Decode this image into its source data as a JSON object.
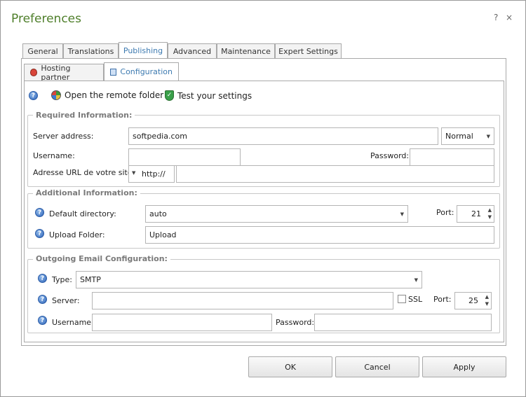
{
  "window": {
    "title": "Preferences",
    "help": "?",
    "close": "×"
  },
  "tabs": [
    {
      "label": "General"
    },
    {
      "label": "Translations"
    },
    {
      "label": "Publishing"
    },
    {
      "label": "Advanced"
    },
    {
      "label": "Maintenance"
    },
    {
      "label": "Expert Settings"
    }
  ],
  "subtabs": [
    {
      "label": "Hosting partner"
    },
    {
      "label": "Configuration"
    }
  ],
  "toolbar": {
    "open_remote": "Open the remote folder",
    "test_settings": "Test your settings"
  },
  "required": {
    "legend": "Required Information:",
    "server_label": "Server address:",
    "server_value": "softpedia.com",
    "mode": "Normal",
    "username_label": "Username:",
    "username_value": "",
    "password_label": "Password:",
    "password_value": "",
    "url_label": "Adresse URL de votre site :",
    "protocol": "http://",
    "url_value": ""
  },
  "additional": {
    "legend": "Additional Information:",
    "directory_label": "Default directory:",
    "directory_value": "auto",
    "port_label": "Port:",
    "port_value": "21",
    "upload_label": "Upload Folder:",
    "upload_value": "Upload"
  },
  "email": {
    "legend": "Outgoing Email Configuration:",
    "type_label": "Type:",
    "type_value": "SMTP",
    "server_label": "Server:",
    "server_value": "",
    "ssl_label": "SSL",
    "port_label": "Port:",
    "port_value": "25",
    "username_label": "Username:",
    "username_value": "",
    "password_label": "Password:",
    "password_value": ""
  },
  "buttons": {
    "ok": "OK",
    "cancel": "Cancel",
    "apply": "Apply"
  }
}
